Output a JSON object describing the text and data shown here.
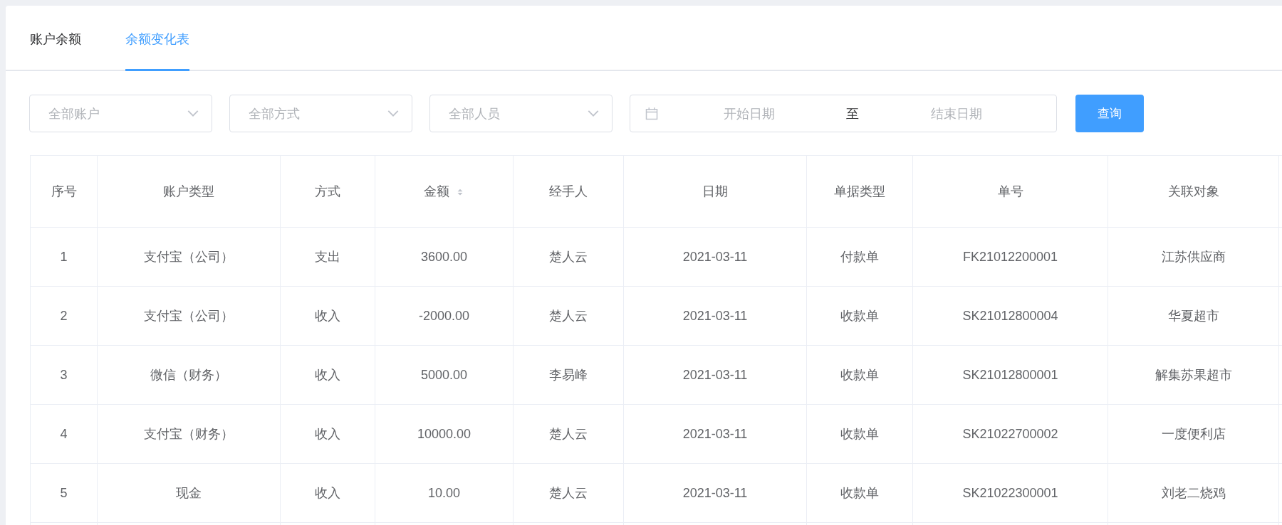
{
  "tabs": [
    {
      "label": "账户余额",
      "selected": false
    },
    {
      "label": "余额变化表",
      "selected": true
    }
  ],
  "filters": {
    "selects": [
      {
        "placeholder": "全部账户"
      },
      {
        "placeholder": "全部方式"
      },
      {
        "placeholder": "全部人员"
      }
    ],
    "date_range": {
      "start_placeholder": "开始日期",
      "separator": "至",
      "end_placeholder": "结束日期"
    },
    "query_button": "查询"
  },
  "table": {
    "columns": [
      {
        "label": "序号",
        "sortable": false
      },
      {
        "label": "账户类型",
        "sortable": false
      },
      {
        "label": "方式",
        "sortable": false
      },
      {
        "label": "金额",
        "sortable": true
      },
      {
        "label": "经手人",
        "sortable": false
      },
      {
        "label": "日期",
        "sortable": false
      },
      {
        "label": "单据类型",
        "sortable": false
      },
      {
        "label": "单号",
        "sortable": false
      },
      {
        "label": "关联对象",
        "sortable": false
      }
    ],
    "rows": [
      [
        "1",
        "支付宝（公司）",
        "支出",
        "3600.00",
        "楚人云",
        "2021-03-11",
        "付款单",
        "FK21012200001",
        "江苏供应商"
      ],
      [
        "2",
        "支付宝（公司）",
        "收入",
        "-2000.00",
        "楚人云",
        "2021-03-11",
        "收款单",
        "SK21012800004",
        "华夏超市"
      ],
      [
        "3",
        "微信（财务）",
        "收入",
        "5000.00",
        "李易峰",
        "2021-03-11",
        "收款单",
        "SK21012800001",
        "解集苏果超市"
      ],
      [
        "4",
        "支付宝（财务）",
        "收入",
        "10000.00",
        "楚人云",
        "2021-03-11",
        "收款单",
        "SK21022700002",
        "一度便利店"
      ],
      [
        "5",
        "现金",
        "收入",
        "10.00",
        "楚人云",
        "2021-03-11",
        "收款单",
        "SK21022300001",
        "刘老二烧鸡"
      ]
    ]
  }
}
